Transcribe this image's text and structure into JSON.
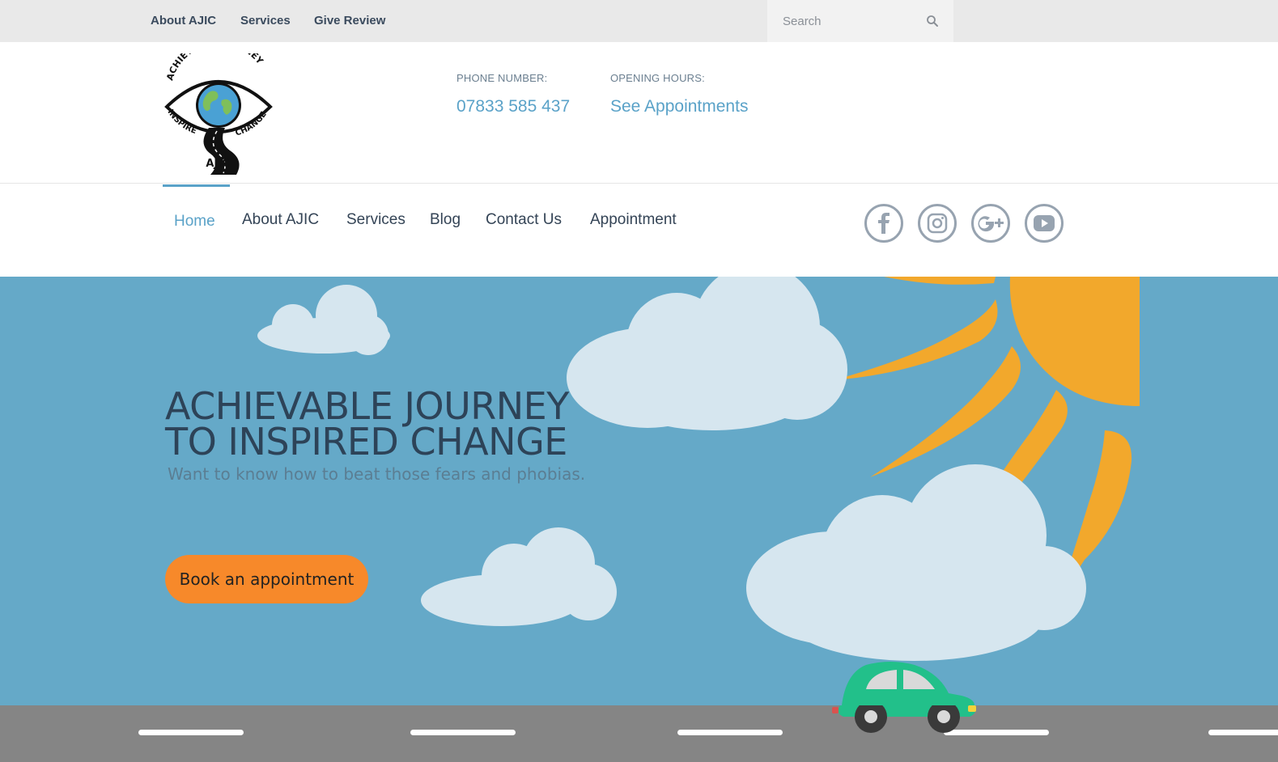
{
  "topbar": {
    "links": [
      "About AJIC",
      "Services",
      "Give Review"
    ],
    "search_placeholder": "Search"
  },
  "header": {
    "logo": {
      "arc_top": "ACHIEVABLE JOURNEY",
      "arc_left": "INSPIRE",
      "arc_right": "CHANGE",
      "brand": "AJIC"
    },
    "phone_label": "PHONE NUMBER:",
    "phone_value": "07833 585 437",
    "hours_label": "OPENING HOURS:",
    "hours_value": "See Appointments"
  },
  "nav": {
    "items": [
      "Home",
      "About AJIC",
      "Services",
      "Blog",
      "Contact Us",
      "Appointment"
    ],
    "active": "Home",
    "social_icons": [
      "facebook-icon",
      "instagram-icon",
      "google-plus-icon",
      "youtube-icon"
    ]
  },
  "hero": {
    "title_line1": "ACHIEVABLE JOURNEY",
    "title_line2": "TO INSPIRED CHANGE",
    "subtitle": "Want to know how to beat those fears and phobias.",
    "cta": "Book an appointment"
  },
  "colors": {
    "accent": "#5aa2c8",
    "sky": "#65a9c8",
    "sun": "#f2a82c",
    "button": "#f7892a",
    "car": "#22c08a",
    "road": "#858585",
    "nav_text": "#344456"
  }
}
